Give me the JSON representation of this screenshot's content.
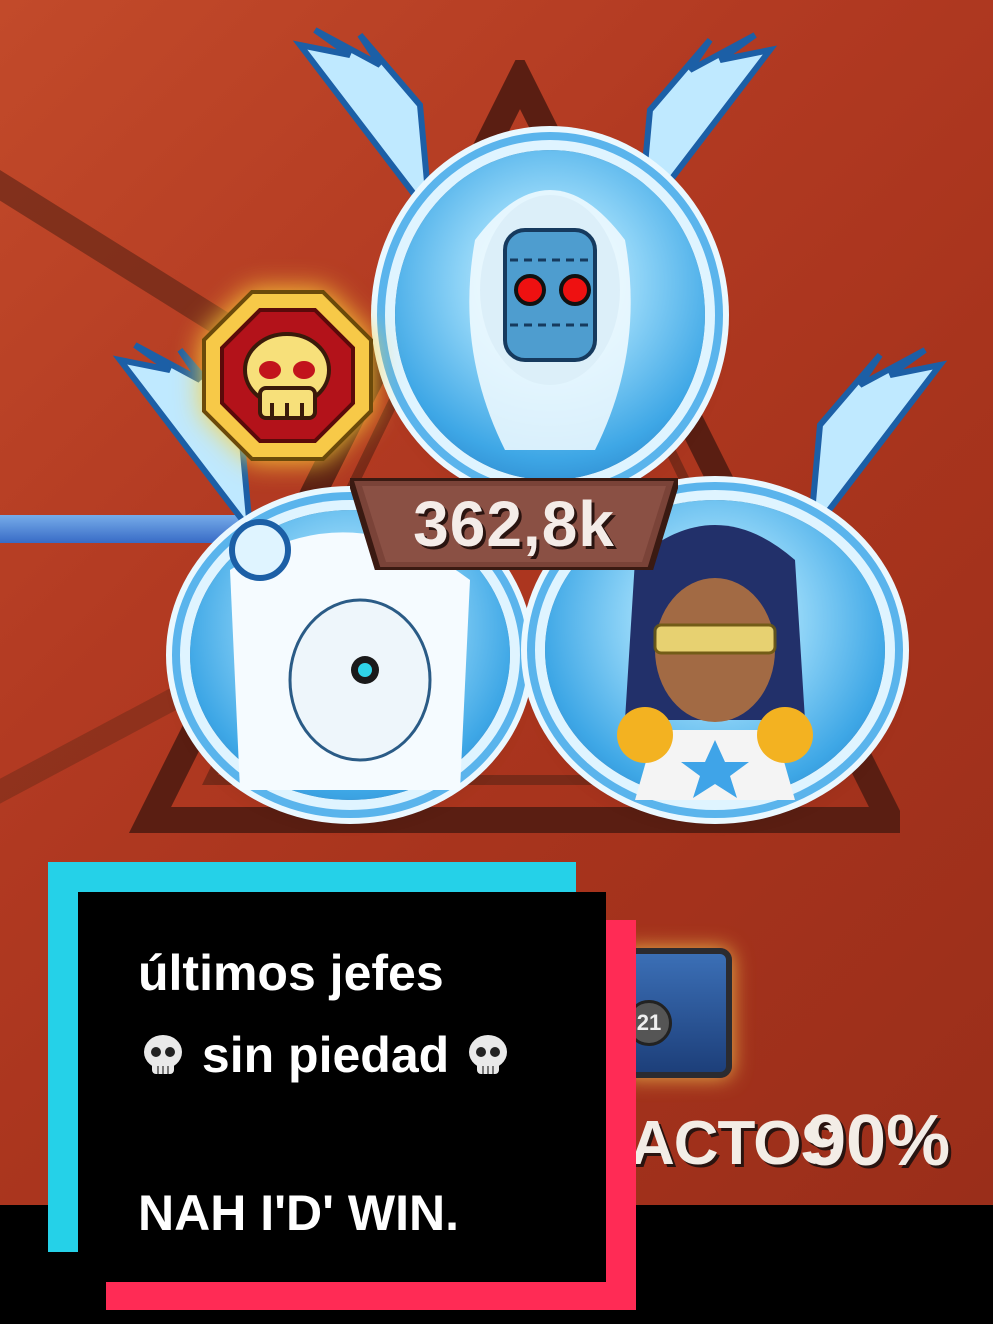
{
  "boss_panel": {
    "score": "362,8k",
    "badge_icon": "skull-icon"
  },
  "rewards": {
    "chest_count": "21",
    "stat_label": "ACTOS",
    "stat_value": "90%"
  },
  "caption": {
    "line1": "últimos jefes",
    "line2": "sin piedad",
    "line3": "NAH  I'D'  WIN."
  },
  "colors": {
    "caption_cyan": "#25d1e8",
    "caption_red": "#ff2b55",
    "background": "#b23a22"
  }
}
